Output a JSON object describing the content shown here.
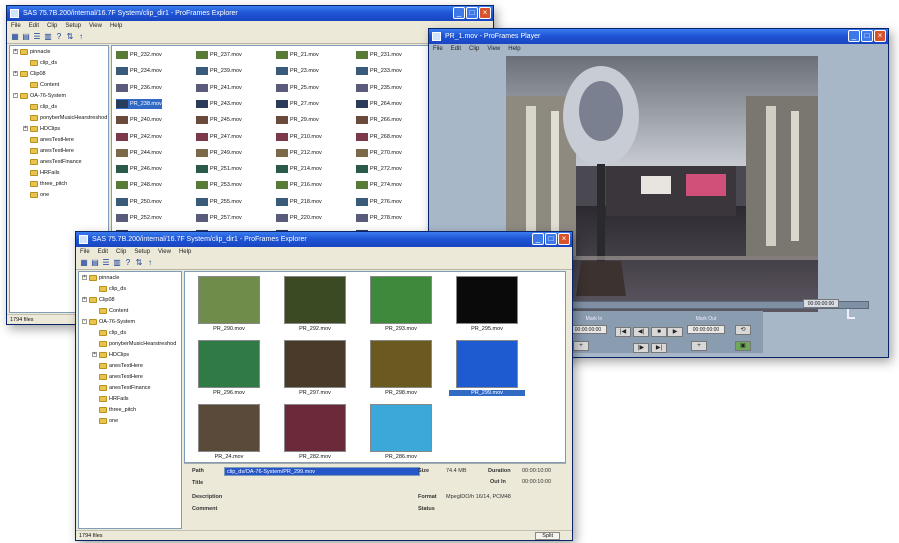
{
  "explorer1": {
    "title": "SAS 75.7B.200/internal/16.7F System/clip_dir1 - ProFrames Explorer",
    "menu": [
      "File",
      "Edit",
      "Clip",
      "Setup",
      "View",
      "Help"
    ],
    "tree": [
      {
        "label": "pinnacle",
        "depth": 0,
        "exp": "+"
      },
      {
        "label": "clip_ds",
        "depth": 1,
        "exp": ""
      },
      {
        "label": "Clip08",
        "depth": 0,
        "exp": "+"
      },
      {
        "label": "Content",
        "depth": 1,
        "exp": ""
      },
      {
        "label": "OA-76-System",
        "depth": 0,
        "exp": "-"
      },
      {
        "label": "clip_ds",
        "depth": 1,
        "exp": ""
      },
      {
        "label": "ponyberMusicHearstreshod",
        "depth": 1,
        "exp": ""
      },
      {
        "label": "HDClips",
        "depth": 1,
        "exp": "+"
      },
      {
        "label": "anesTestHere",
        "depth": 1,
        "exp": ""
      },
      {
        "label": "anesTestHere",
        "depth": 1,
        "exp": ""
      },
      {
        "label": "anesTestFinance",
        "depth": 1,
        "exp": ""
      },
      {
        "label": "HRFails",
        "depth": 1,
        "exp": ""
      },
      {
        "label": "three_pitch",
        "depth": 1,
        "exp": ""
      },
      {
        "label": "one",
        "depth": 1,
        "exp": ""
      }
    ],
    "files": [
      "PR_232.mov",
      "PR_234.mov",
      "PR_236.mov",
      "PR_238.mov",
      "PR_240.mov",
      "PR_242.mov",
      "PR_244.mov",
      "PR_246.mov",
      "PR_248.mov",
      "PR_250.mov",
      "PR_252.mov",
      "PR_254.mov",
      "PR_256.mov",
      "PR_258.mov",
      "PR_260.mov",
      "PR_262.mov",
      "PR_237.mov",
      "PR_239.mov",
      "PR_241.mov",
      "PR_243.mov",
      "PR_245.mov",
      "PR_247.mov",
      "PR_249.mov",
      "PR_251.mov",
      "PR_253.mov",
      "PR_255.mov",
      "PR_257.mov",
      "PR_259.mov",
      "PR_261.mov",
      "PR_263.mov",
      "PR_265.mov",
      "PR_267.mov",
      "PR_21.mov",
      "PR_23.mov",
      "PR_25.mov",
      "PR_27.mov",
      "PR_29.mov",
      "PR_210.mov",
      "PR_212.mov",
      "PR_214.mov",
      "PR_216.mov",
      "PR_218.mov",
      "PR_220.mov",
      "PR_222.mov",
      "PR_224.mov",
      "PR_226.mov",
      "PR_228.mov",
      "PR_230.mov",
      "PR_231.mov",
      "PR_233.mov",
      "PR_235.mov",
      "PR_264.mov",
      "PR_266.mov",
      "PR_268.mov",
      "PR_270.mov",
      "PR_272.mov",
      "PR_274.mov",
      "PR_276.mov",
      "PR_278.mov",
      "PR_280.mov",
      "PR_282.mov",
      "PR_284.mov",
      "PR_286.mov",
      "PR_288.mov"
    ],
    "status": "1794 files"
  },
  "explorer2": {
    "title": "SAS 75.7B.200/internal/16.7F System/clip_dir1 - ProFrames Explorer",
    "menu": [
      "File",
      "Edit",
      "Clip",
      "Setup",
      "View",
      "Help"
    ],
    "tree": [
      {
        "label": "pinnacle",
        "depth": 0,
        "exp": "+"
      },
      {
        "label": "clip_ds",
        "depth": 1,
        "exp": ""
      },
      {
        "label": "Clip08",
        "depth": 0,
        "exp": "+"
      },
      {
        "label": "Content",
        "depth": 1,
        "exp": ""
      },
      {
        "label": "OA-76-System",
        "depth": 0,
        "exp": "-"
      },
      {
        "label": "clip_ds",
        "depth": 1,
        "exp": ""
      },
      {
        "label": "ponyberMusicHearstreshod",
        "depth": 1,
        "exp": ""
      },
      {
        "label": "HDClips",
        "depth": 1,
        "exp": "+"
      },
      {
        "label": "anesTestHere",
        "depth": 1,
        "exp": ""
      },
      {
        "label": "anesTestHere",
        "depth": 1,
        "exp": ""
      },
      {
        "label": "anesTestFinance",
        "depth": 1,
        "exp": ""
      },
      {
        "label": "HRFails",
        "depth": 1,
        "exp": ""
      },
      {
        "label": "three_pitch",
        "depth": 1,
        "exp": ""
      },
      {
        "label": "one",
        "depth": 1,
        "exp": ""
      }
    ],
    "thumbs": [
      {
        "label": "PR_290.mov",
        "color": "#6f8c4a"
      },
      {
        "label": "PR_292.mov",
        "color": "#3b4a22"
      },
      {
        "label": "PR_293.mov",
        "color": "#3e8a3c"
      },
      {
        "label": "PR_295.mov",
        "color": "#0a0a0a"
      },
      {
        "label": "PR_296.mov",
        "color": "#2f7a45"
      },
      {
        "label": "PR_297.mov",
        "color": "#4a3a2a"
      },
      {
        "label": "PR_298.mov",
        "color": "#6a5a1f"
      },
      {
        "label": "PR_299.mov",
        "color": "#1e5ad0"
      },
      {
        "label": "PR_24.mov",
        "color": "#5a4a3a"
      },
      {
        "label": "PR_282.mov",
        "color": "#6a2a3a"
      },
      {
        "label": "PR_286.mov",
        "color": "#3aa8d8"
      }
    ],
    "properties": {
      "path_label": "Path",
      "path_value": "clip_ds/OA-76-System/PR_299.mov",
      "title_label": "Title",
      "description_label": "Description",
      "comment_label": "Comment",
      "size_label": "Size",
      "size_value": "74.4 MB",
      "duration_label": "Duration",
      "duration_value": "00:00:10:00",
      "outin_label": "Out In",
      "outin_value": "00:00:10:00",
      "format_label": "Format",
      "format_value": "MpegIDO/h 16/14, PCM48",
      "status_label": "Status",
      "ok_label": "Split"
    },
    "status": "1794 files"
  },
  "player": {
    "title": "PR_1.mov - ProFrames Player",
    "menu": [
      "File",
      "Edit",
      "Clip",
      "View",
      "Help"
    ],
    "timecode_left": "",
    "timecode_right": "00:00:00:00",
    "controls": [
      {
        "icon": "skip-start-icon",
        "glyph": "|◀"
      },
      {
        "icon": "step-back-icon",
        "glyph": "◀|"
      },
      {
        "icon": "stop-icon",
        "glyph": "■"
      },
      {
        "icon": "play-icon",
        "glyph": "▶"
      },
      {
        "icon": "step-forward-icon",
        "glyph": "|▶"
      },
      {
        "icon": "skip-end-icon",
        "glyph": "▶|"
      }
    ],
    "jog_labels": [
      "Mark In",
      "Mark Out"
    ],
    "jog_values": [
      "00:00:00:00",
      "00:00:00:00"
    ],
    "colors": {
      "body": "#a7b7c8",
      "panel": "#8a9cb0"
    }
  }
}
